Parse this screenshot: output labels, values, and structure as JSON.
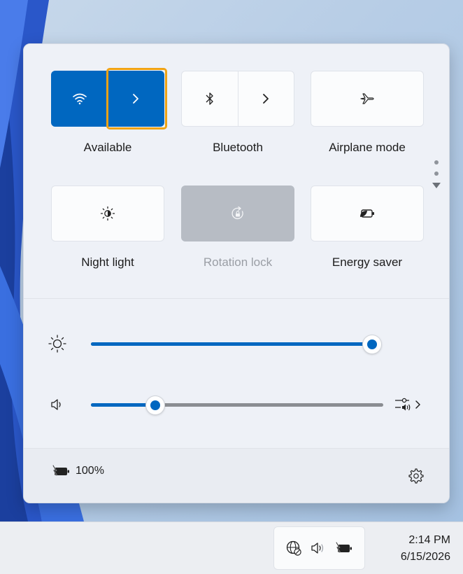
{
  "quick_settings": {
    "tiles": [
      {
        "id": "wifi",
        "label": "Available",
        "state": "on",
        "icon": "wifi-icon",
        "has_chevron": true
      },
      {
        "id": "bluetooth",
        "label": "Bluetooth",
        "state": "off",
        "icon": "bluetooth-icon",
        "has_chevron": true
      },
      {
        "id": "airplane",
        "label": "Airplane mode",
        "state": "off",
        "icon": "airplane-icon"
      },
      {
        "id": "night_light",
        "label": "Night light",
        "state": "off",
        "icon": "night-light-icon"
      },
      {
        "id": "rotation_lock",
        "label": "Rotation lock",
        "state": "disabled",
        "icon": "rotation-lock-icon"
      },
      {
        "id": "energy_saver",
        "label": "Energy saver",
        "state": "off",
        "icon": "energy-saver-icon"
      }
    ],
    "brightness": {
      "icon": "brightness-icon",
      "value_percent": 100
    },
    "volume": {
      "icon": "speaker-icon",
      "value_percent": 22
    },
    "battery": {
      "icon": "battery-charging-icon",
      "percent_label": "100%"
    },
    "settings_icon": "gear-icon"
  },
  "taskbar": {
    "tray_icons": [
      "no-internet-globe-icon",
      "speaker-icon",
      "battery-charging-icon"
    ],
    "time": "2:14 PM",
    "date": "6/15/2026"
  },
  "colors": {
    "accent": "#0067c0",
    "focus": "#f0a314",
    "disabled_tile": "#b7bcc4"
  }
}
